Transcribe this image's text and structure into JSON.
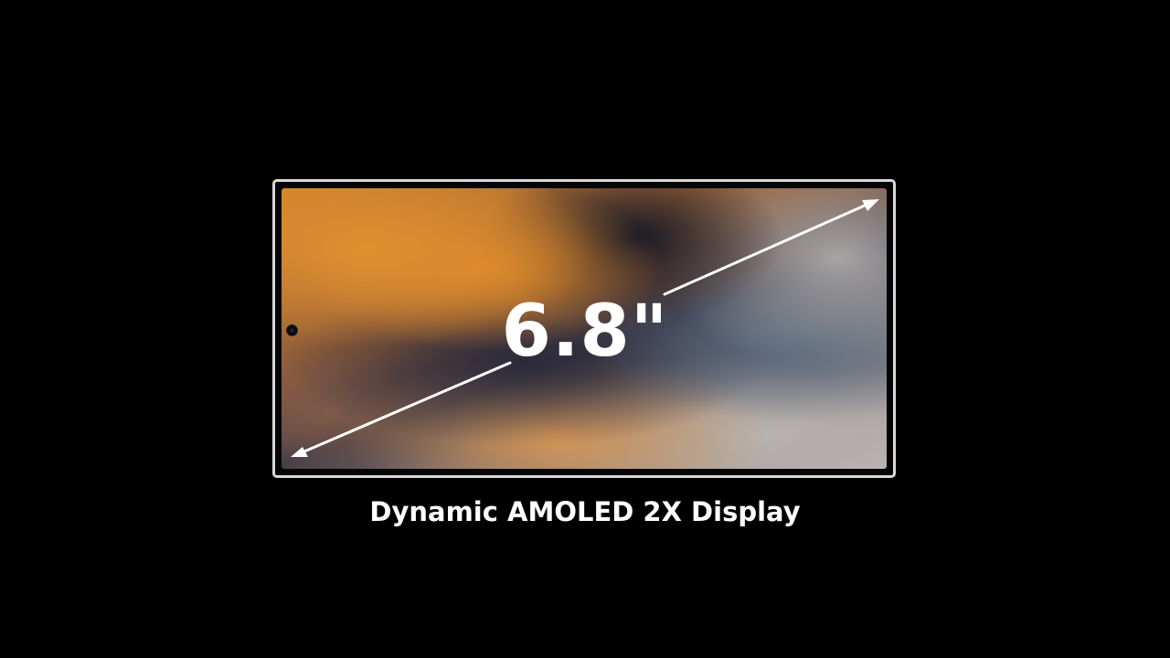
{
  "display": {
    "size_label": "6.8\"",
    "caption": "Dynamic AMOLED 2X Display"
  },
  "icons": {
    "camera": "front-camera-icon",
    "diagonal_arrow": "double-headed-arrow-icon"
  },
  "colors": {
    "background": "#000000",
    "frame": "#d9d9d9",
    "text": "#ffffff",
    "arrow": "#ffffff"
  }
}
